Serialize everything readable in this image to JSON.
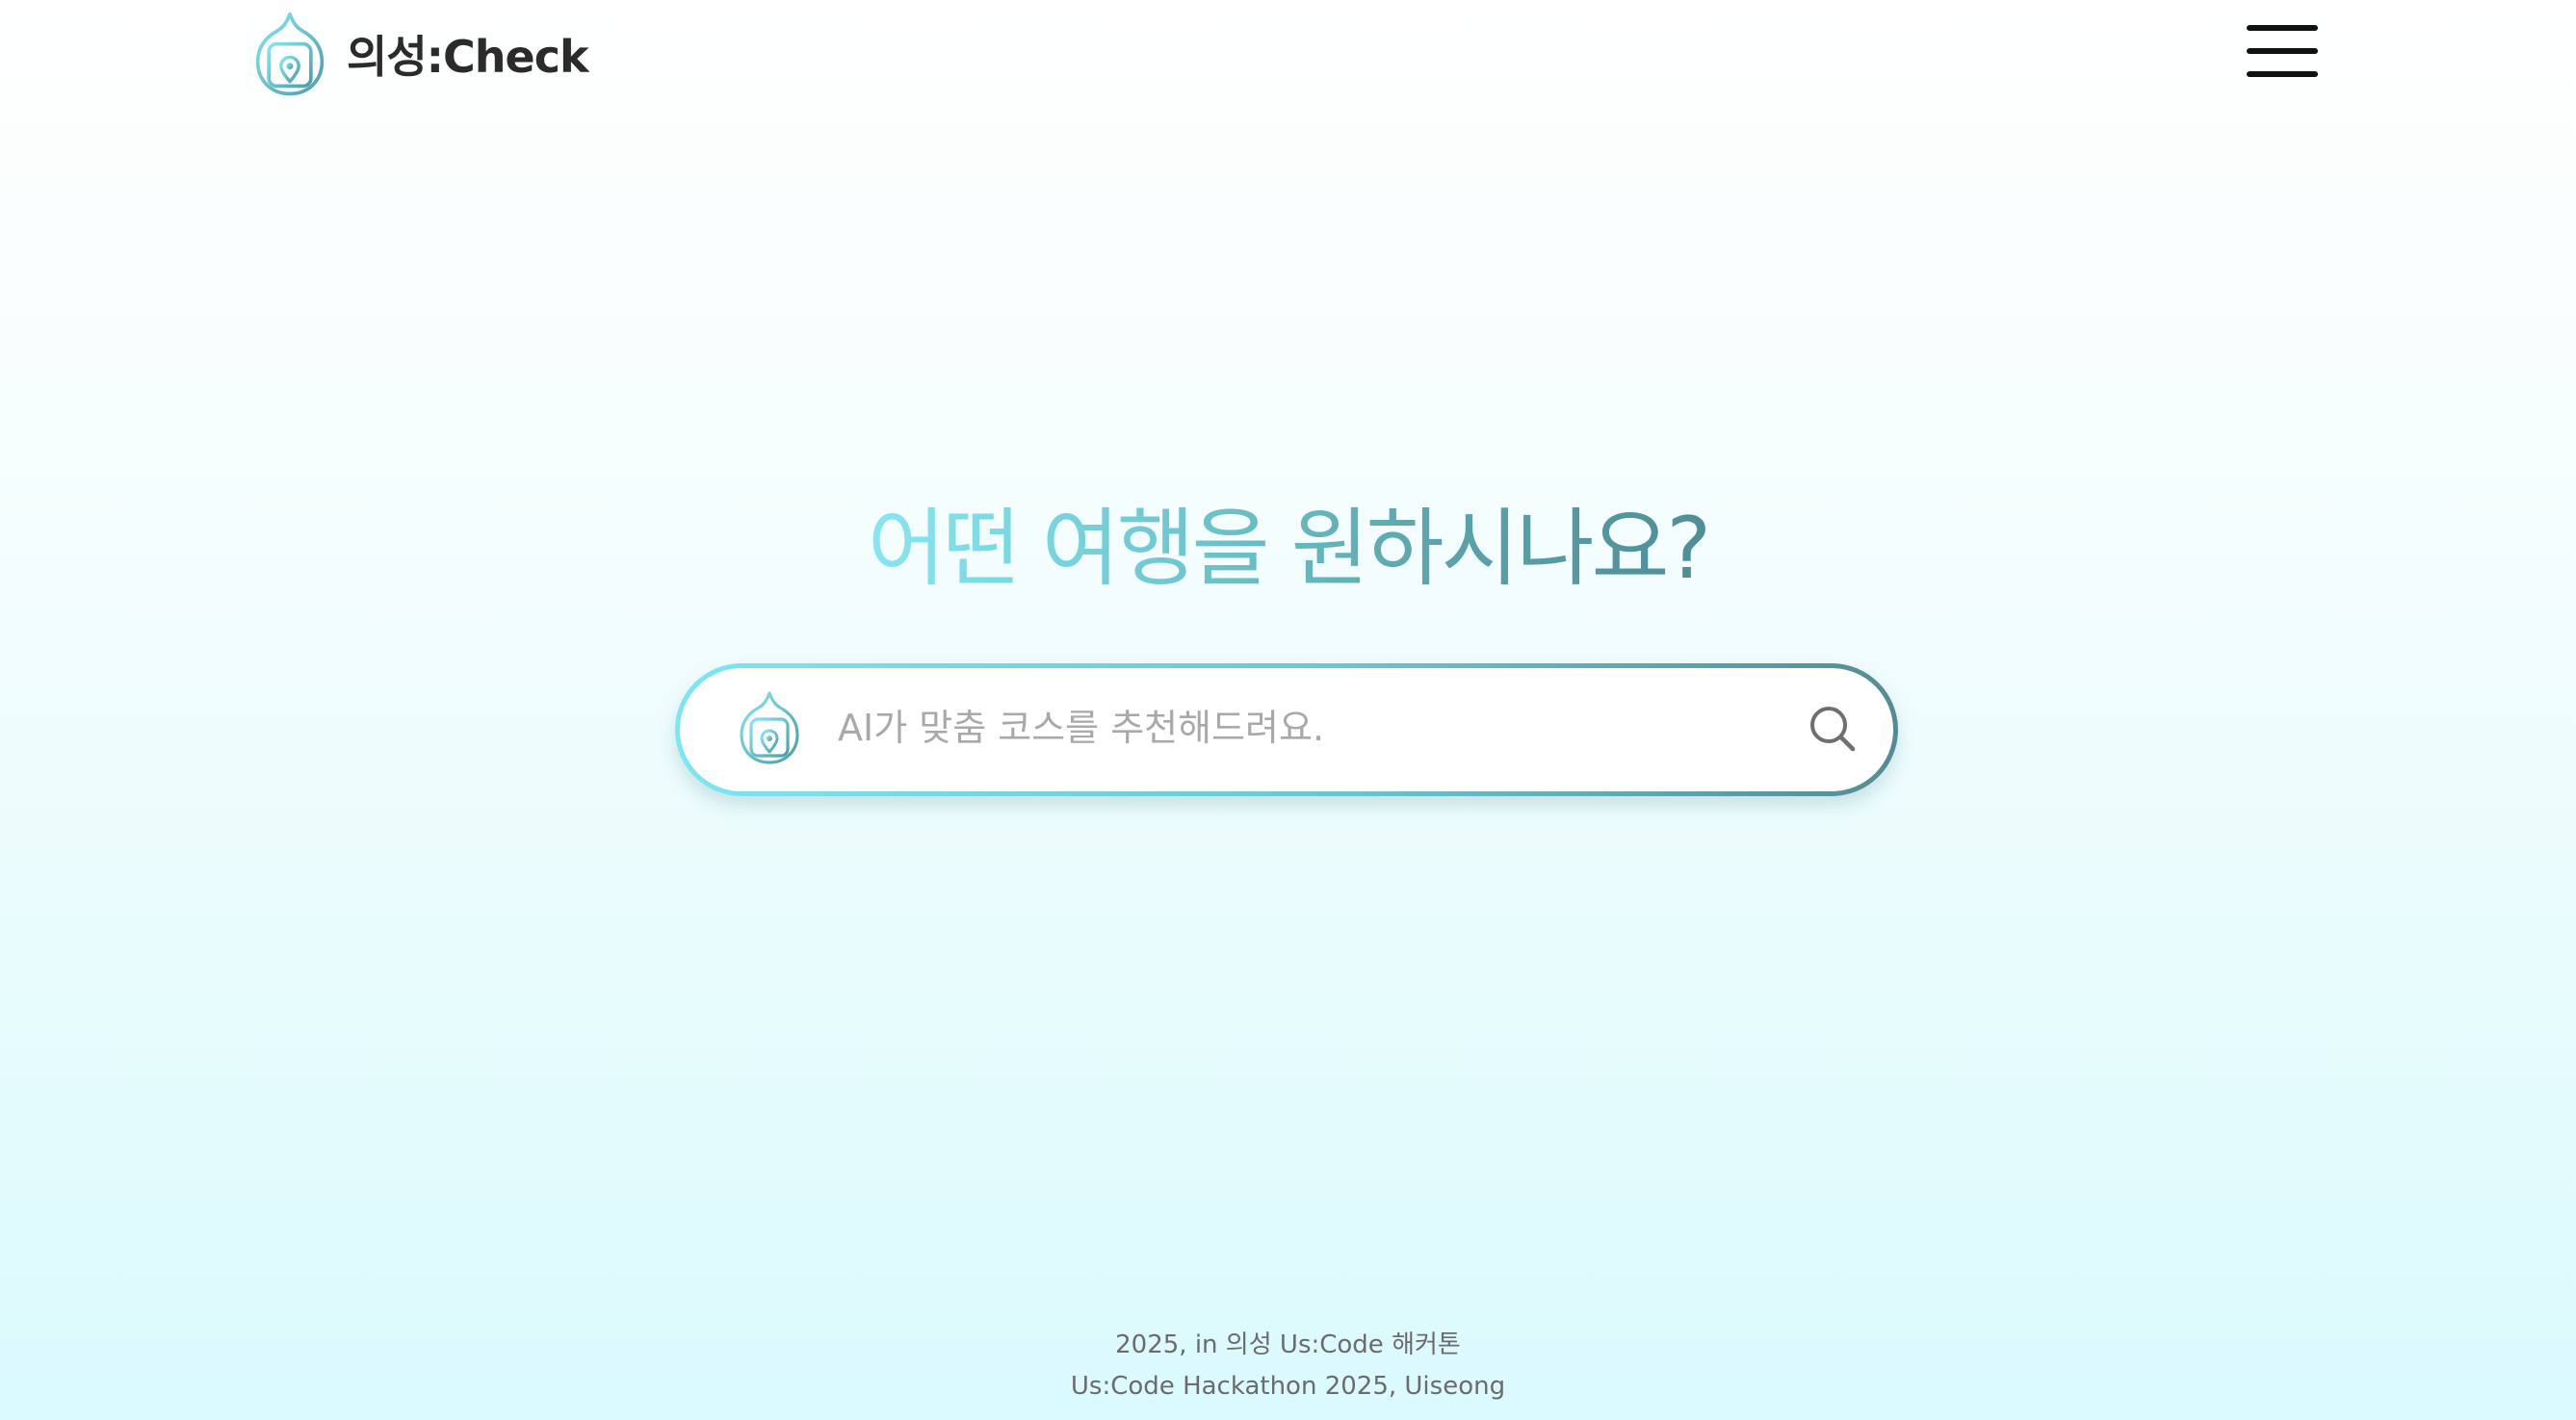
{
  "header": {
    "brand_name": "의성:Check",
    "logo_icon": "onion-calendar-pin-icon",
    "menu_icon": "hamburger-menu-icon"
  },
  "hero": {
    "title": "어떤 여행을 원하시나요?"
  },
  "search": {
    "placeholder": "AI가 맞춤 코스를 추천해드려요.",
    "value": "",
    "logo_icon": "onion-calendar-pin-icon",
    "button_icon": "search-icon"
  },
  "footer": {
    "line1": "2025, in 의성 Us:Code 해커톤",
    "line2": "Us:Code Hackathon 2025, Uiseong"
  },
  "colors": {
    "gradient_start": "#86e6f2",
    "gradient_end": "#4e8e97",
    "text_dark": "#2b2b2b",
    "placeholder": "#a9a9a9",
    "footer_text": "#6b6b6b"
  }
}
